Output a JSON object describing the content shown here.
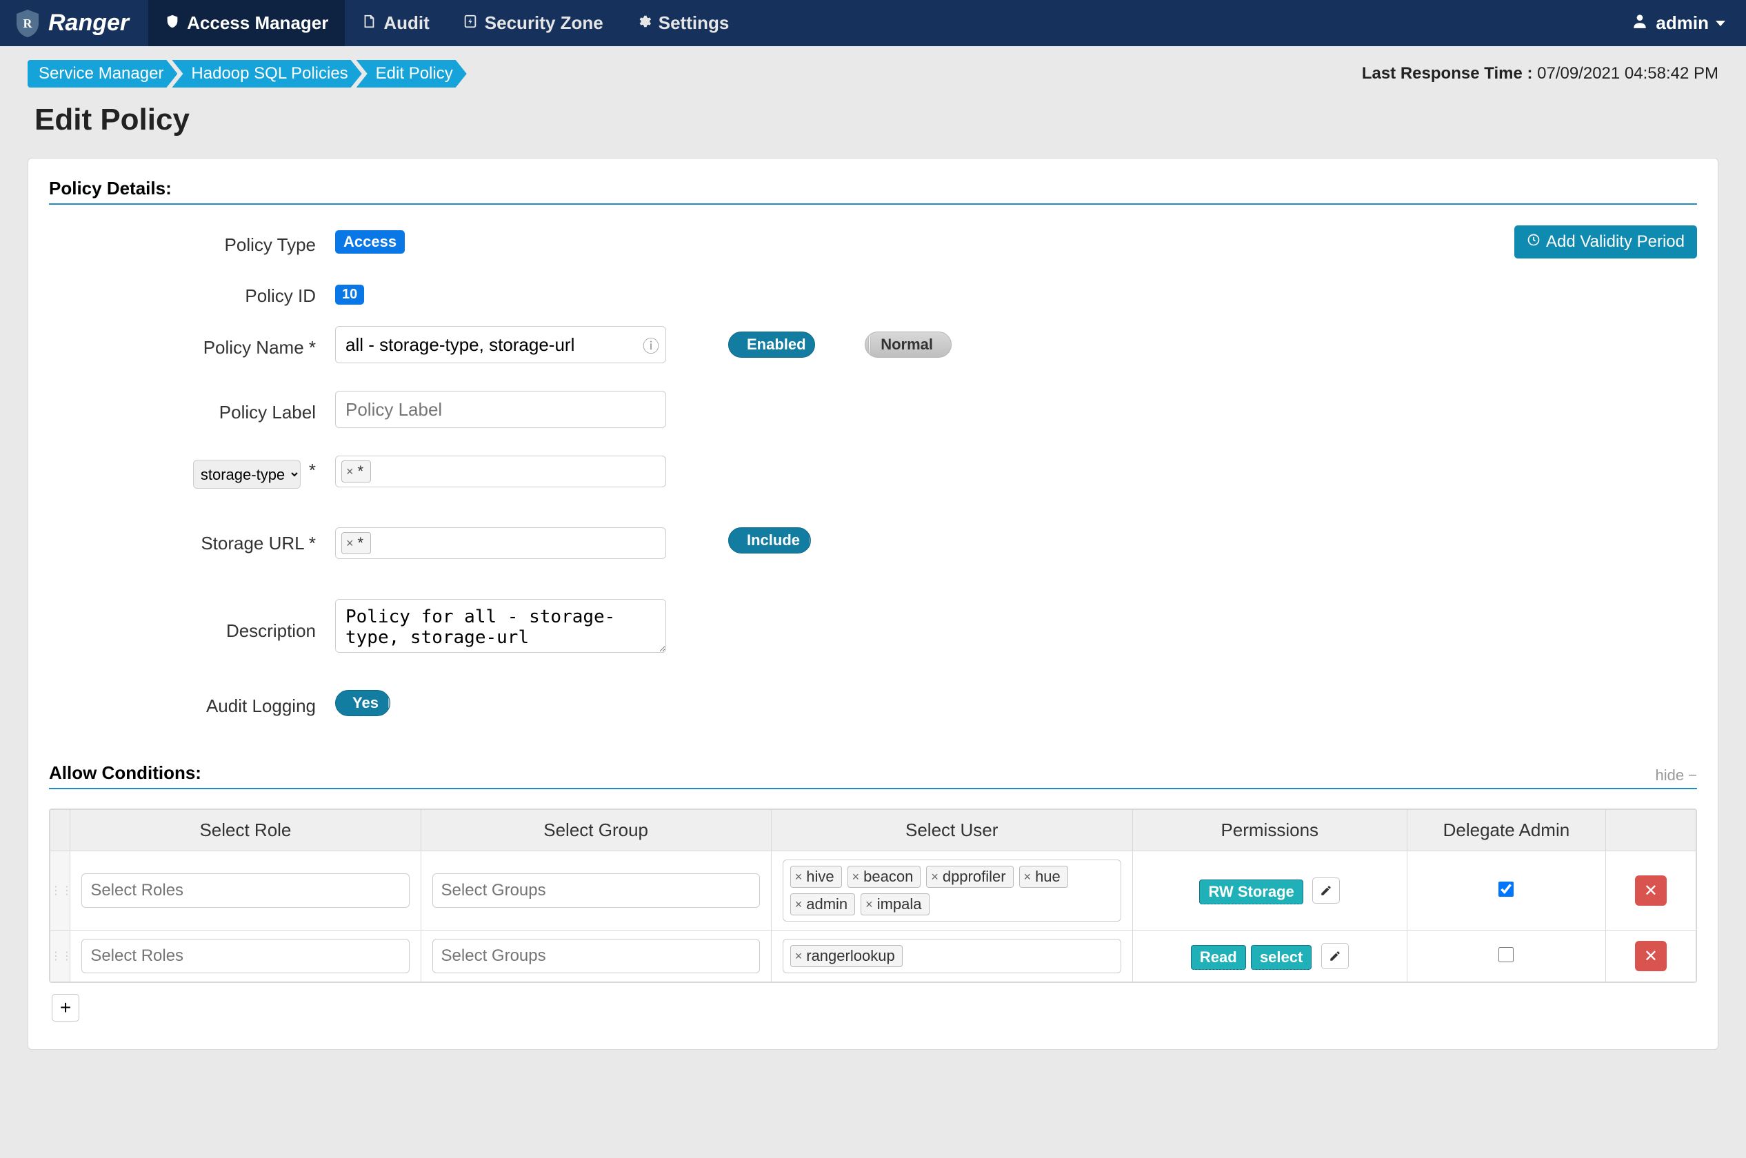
{
  "brand": "Ranger",
  "nav": {
    "access_manager": "Access Manager",
    "audit": "Audit",
    "security_zone": "Security Zone",
    "settings": "Settings",
    "user": "admin"
  },
  "breadcrumbs": {
    "service_manager": "Service Manager",
    "hadoop_sql": "Hadoop SQL Policies",
    "edit_policy": "Edit Policy"
  },
  "resp_time_label": "Last Response Time : ",
  "resp_time_value": "07/09/2021 04:58:42 PM",
  "page_title": "Edit Policy",
  "section_policy_details": "Policy Details:",
  "labels": {
    "policy_type": "Policy Type",
    "policy_id": "Policy ID",
    "policy_name": "Policy Name *",
    "policy_label": "Policy Label",
    "storage_url": "Storage URL *",
    "description": "Description",
    "audit_logging": "Audit Logging"
  },
  "values": {
    "policy_type": "Access",
    "policy_id": "10",
    "policy_name": "all - storage-type, storage-url",
    "policy_label_placeholder": "Policy Label",
    "resource_select": "storage-type",
    "storage_type_tag": "*",
    "storage_url_tag": "*",
    "description": "Policy for all - storage-type, storage-url"
  },
  "toggles": {
    "enabled": "Enabled",
    "normal": "Normal",
    "include": "Include",
    "yes": "Yes"
  },
  "buttons": {
    "add_validity": "Add Validity Period"
  },
  "allow": {
    "title": "Allow Conditions:",
    "hide": "hide",
    "cols": {
      "role": "Select Role",
      "group": "Select Group",
      "user": "Select User",
      "perm": "Permissions",
      "delegate": "Delegate Admin"
    },
    "placeholders": {
      "roles": "Select Roles",
      "groups": "Select Groups"
    },
    "rows": [
      {
        "users": [
          "hive",
          "beacon",
          "dpprofiler",
          "hue",
          "admin",
          "impala"
        ],
        "perms": [
          "RW Storage"
        ],
        "delegate": true
      },
      {
        "users": [
          "rangerlookup"
        ],
        "perms": [
          "Read",
          "select"
        ],
        "delegate": false
      }
    ]
  }
}
